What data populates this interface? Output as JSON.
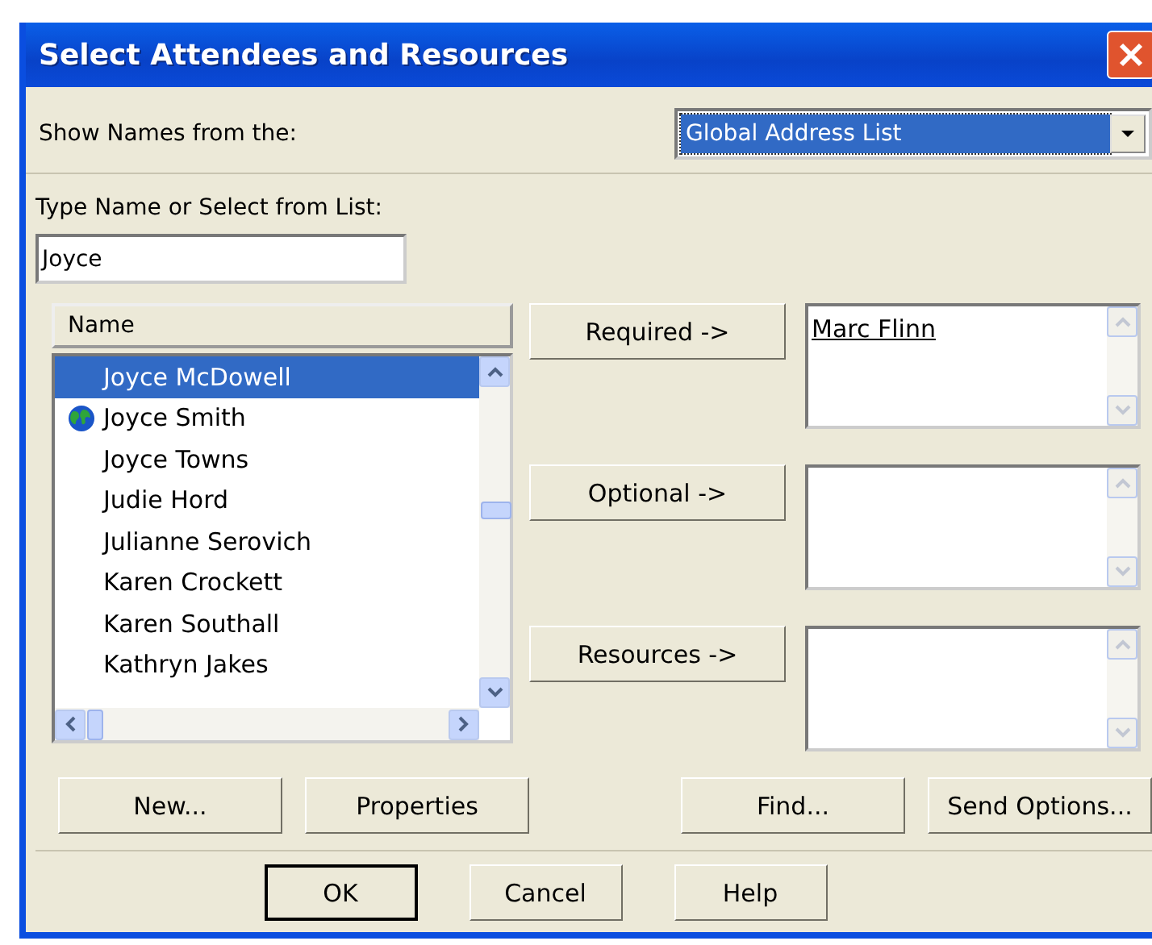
{
  "window": {
    "title": "Select Attendees and Resources"
  },
  "source": {
    "label": "Show Names from the:",
    "value": "Global Address List"
  },
  "search": {
    "label": "Type Name or Select from List:",
    "value": "Joyce"
  },
  "list": {
    "column": "Name",
    "items": [
      {
        "name": "Joyce McDowell",
        "kind": "plain",
        "selected": true
      },
      {
        "name": "Joyce Smith",
        "kind": "external",
        "selected": false
      },
      {
        "name": "Joyce Towns",
        "kind": "plain",
        "selected": false
      },
      {
        "name": "Judie Hord",
        "kind": "plain",
        "selected": false
      },
      {
        "name": "Julianne Serovich",
        "kind": "plain",
        "selected": false
      },
      {
        "name": "Karen Crockett",
        "kind": "plain",
        "selected": false
      },
      {
        "name": "Karen Southall",
        "kind": "plain",
        "selected": false
      },
      {
        "name": "Kathryn Jakes",
        "kind": "plain",
        "selected": false
      }
    ]
  },
  "recipients": [
    {
      "button": "Required ->",
      "names": [
        "Marc Flinn"
      ]
    },
    {
      "button": "Optional ->"
    },
    {
      "button": "Resources ->"
    }
  ],
  "actions": [
    "New...",
    "Properties",
    "Find...",
    "Send Options..."
  ],
  "footer": [
    {
      "label": "OK",
      "default": true
    },
    {
      "label": "Cancel",
      "default": false
    },
    {
      "label": "Help",
      "default": false
    }
  ]
}
